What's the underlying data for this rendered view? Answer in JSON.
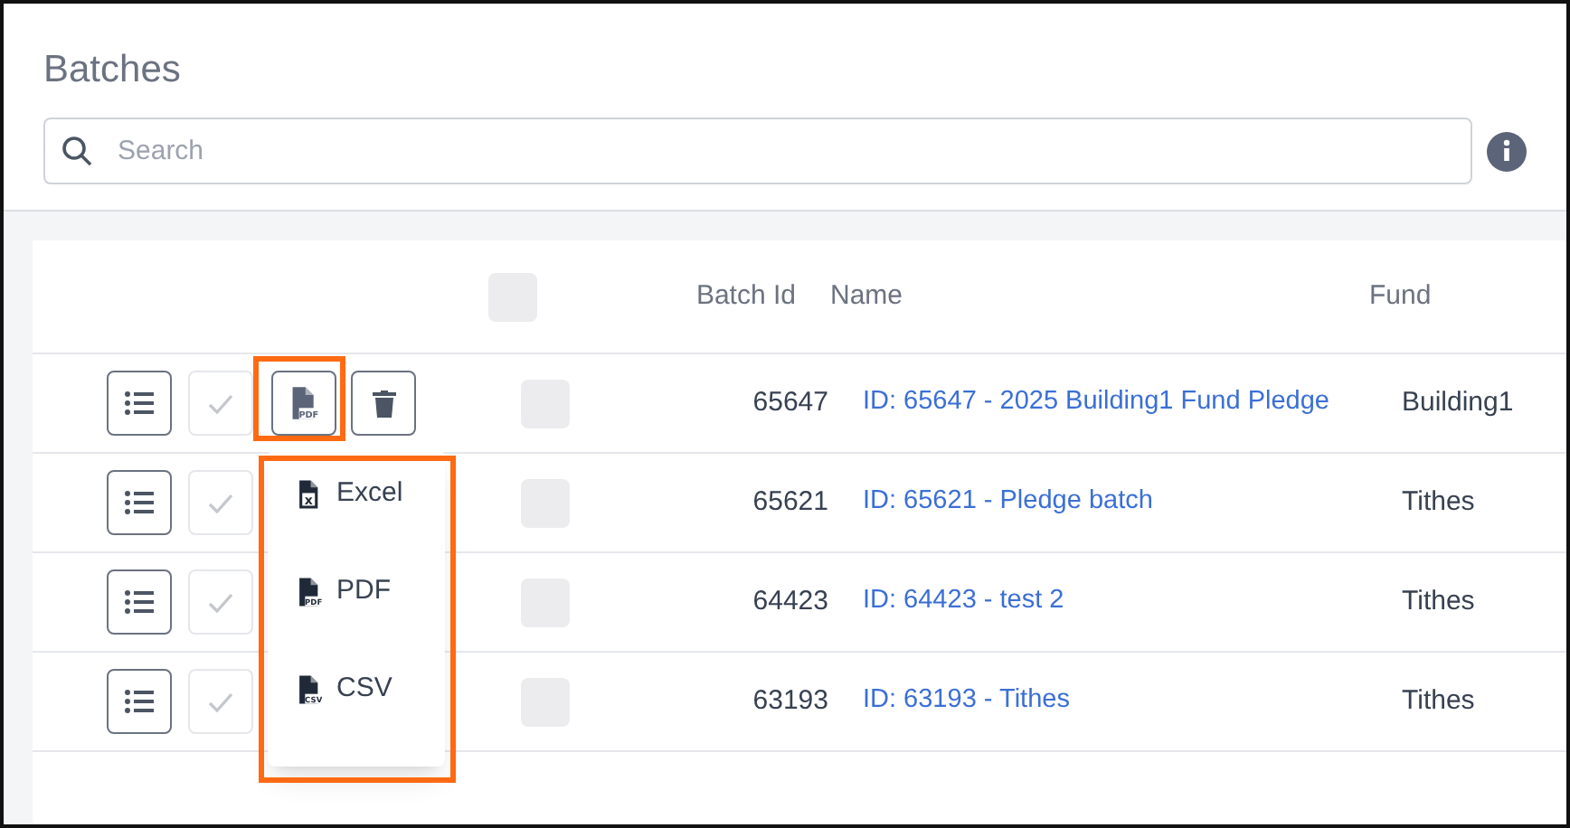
{
  "title": "Batches",
  "search": {
    "placeholder": "Search"
  },
  "table": {
    "columns": [
      "Batch Id",
      "Name",
      "Fund"
    ],
    "header_checked": false,
    "rows": [
      {
        "batch_id": "65647",
        "name": "ID: 65647 - 2025 Building1 Fund Pledge",
        "fund": "Building1",
        "checked": false,
        "approve_disabled": true,
        "export_tag": "PDF",
        "menu_open": true
      },
      {
        "batch_id": "65621",
        "name": "ID: 65621 - Pledge batch",
        "fund": "Tithes",
        "checked": false,
        "approve_disabled": true,
        "menu_open": false
      },
      {
        "batch_id": "64423",
        "name": "ID: 64423 - test 2",
        "fund": "Tithes",
        "checked": false,
        "approve_disabled": true,
        "menu_open": false
      },
      {
        "batch_id": "63193",
        "name": "ID: 63193 - Tithes",
        "fund": "Tithes",
        "checked": false,
        "approve_disabled": true,
        "menu_open": false
      }
    ]
  },
  "export_menu": {
    "items": [
      {
        "label": "Excel",
        "tag": "x"
      },
      {
        "label": "PDF",
        "tag": "PDF"
      },
      {
        "label": "CSV",
        "tag": "CSV"
      }
    ]
  }
}
